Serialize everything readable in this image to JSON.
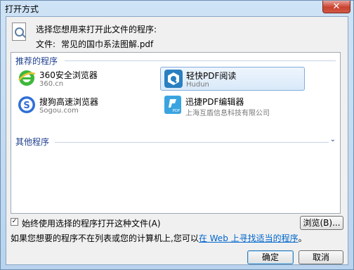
{
  "window": {
    "title": "打开方式",
    "close_glyph": "✕"
  },
  "header": {
    "prompt": "选择您想用来打开此文件的程序:",
    "file_label": "文件:",
    "file_name": "常见的国巾系法图解.pdf"
  },
  "recommended": {
    "header": "推荐的程序",
    "apps": [
      {
        "name": "360安全浏览器",
        "sub": "360.cn",
        "icon": "ie-browser-icon"
      },
      {
        "name": "轻快PDF阅读",
        "sub": "Hudun",
        "icon": "pdf-reader-icon"
      },
      {
        "name": "搜狗高速浏览器",
        "sub": "Sogou.com",
        "icon": "sogou-browser-icon"
      },
      {
        "name": "迅捷PDF编辑器",
        "sub": "上海互盾信息科技有限公司",
        "icon": "pdf-editor-icon"
      }
    ]
  },
  "other": {
    "header": "其他程序",
    "chevron_glyph": "⌄"
  },
  "always_use": {
    "label": "始终使用选择的程序打开这种文件(A)",
    "checked": true,
    "check_glyph": "✓"
  },
  "browse_label": "浏览(B)...",
  "hint": {
    "text": "如果您想要的程序不在列表或您的计算机上,您可以",
    "link": "在 Web 上寻找适当的程序",
    "end": "。"
  },
  "buttons": {
    "ok": "确定",
    "cancel": "取消"
  }
}
